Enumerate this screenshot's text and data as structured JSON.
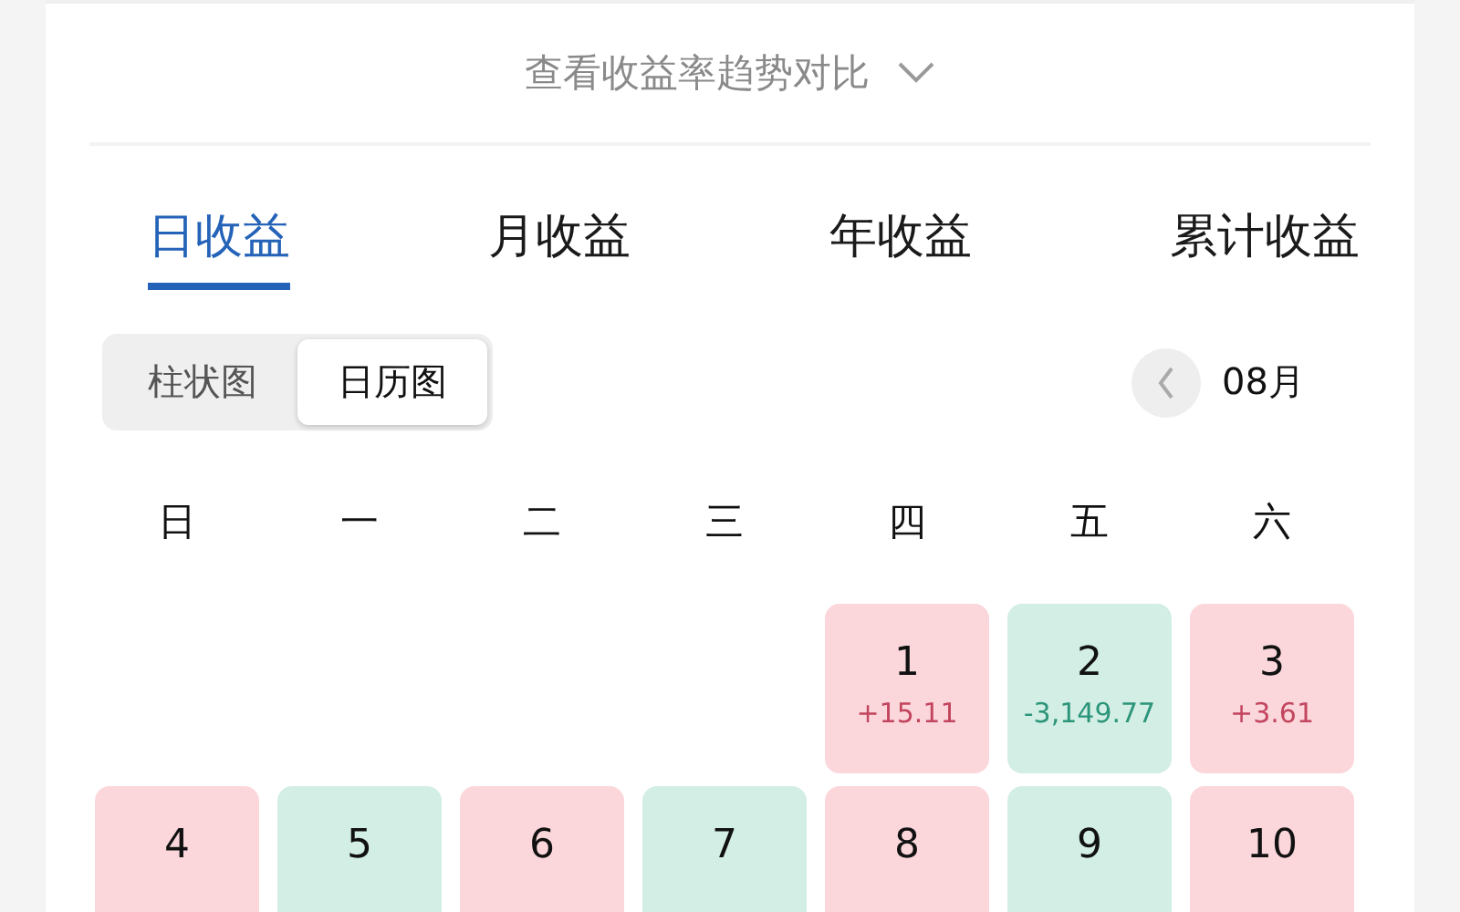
{
  "compare_link": {
    "label": "查看收益率趋势对比",
    "expanded": false
  },
  "tabs": [
    {
      "label": "日收益",
      "selected": true
    },
    {
      "label": "月收益",
      "selected": false
    },
    {
      "label": "年收益",
      "selected": false
    },
    {
      "label": "累计收益",
      "selected": false
    }
  ],
  "view_toggle": [
    {
      "label": "柱状图",
      "selected": false
    },
    {
      "label": "日历图",
      "selected": true
    }
  ],
  "month": "08月",
  "weekdays": [
    "日",
    "一",
    "二",
    "三",
    "四",
    "五",
    "六"
  ],
  "weeks": [
    [
      {
        "day": "1",
        "amount": "+15.11",
        "color": "#fbd7dc"
      },
      {
        "day": "2",
        "amount": "-3,149.77",
        "color": "#d3eee5"
      },
      {
        "day": "3",
        "amount": "+3.61",
        "color": "#fbd7dc"
      }
    ],
    [
      {
        "day": "4",
        "color": "#fbd7dc"
      },
      {
        "day": "5",
        "color": "#d3eee5"
      },
      {
        "day": "6",
        "color": "#fbd7dc"
      },
      {
        "day": "7",
        "color": "#d3eee5"
      },
      {
        "day": "8",
        "color": "#fbd7dc"
      },
      {
        "day": "9",
        "color": "#d3eee5"
      },
      {
        "day": "10",
        "color": "#fbd7dc"
      }
    ]
  ]
}
